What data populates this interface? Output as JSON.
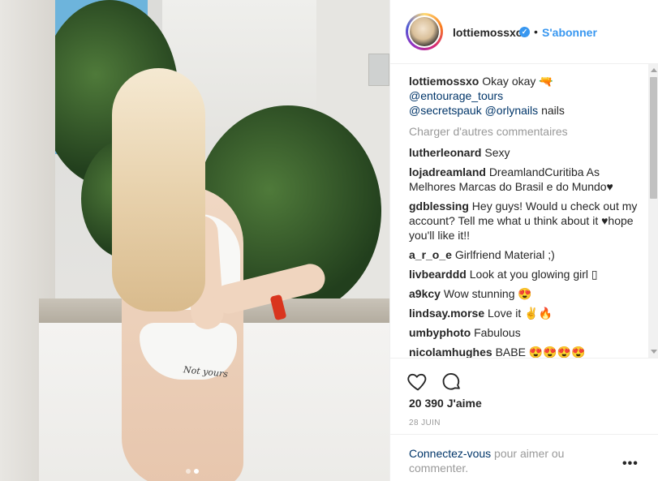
{
  "post": {
    "username": "lottiemossxo",
    "separator": "•",
    "follow_label": "S'abonner",
    "caption": {
      "user": "lottiemossxo",
      "text": "Okay okay 🔫",
      "mention_1": "@entourage_tours",
      "mention_2": "@secretspauk",
      "mention_3": "@orlynails",
      "text_end": "nails"
    },
    "load_more": "Charger d'autres commentaires",
    "comments": [
      {
        "user": "lutherleonard",
        "text": "Sexy"
      },
      {
        "user": "lojadreamland",
        "text": "DreamlandCuritiba As Melhores Marcas do Brasil e do Mundo♥"
      },
      {
        "user": "gdblessing",
        "text": "Hey guys! Would u check out my account? Tell me what u think about it ♥hope you'll like it!!"
      },
      {
        "user": "a_r_o_e",
        "text": "Girlfriend Material ;)"
      },
      {
        "user": "livbearddd",
        "text": "Look at you glowing girl ▯"
      },
      {
        "user": "a9kcy",
        "text": "Wow stunning 😍"
      },
      {
        "user": "lindsay.morse",
        "text": "Love it ✌🔥"
      },
      {
        "user": "umbyphoto",
        "text": "Fabulous"
      },
      {
        "user": "nicolamhughes",
        "text": "BABE 😍😍😍😍"
      }
    ],
    "likes": "20 390 J'aime",
    "date": "28 JUIN",
    "login_link": "Connectez-vous",
    "login_rest": " pour aimer ou commenter.",
    "more_label": "•••",
    "photo_tattoo": "Not yours",
    "carousel_count": 2,
    "carousel_active": 2
  },
  "icons": {
    "heart": "heart-icon",
    "comment": "comment-icon",
    "verified": "verified-badge-icon",
    "more": "more-options-icon"
  },
  "colors": {
    "link": "#3897f0",
    "mention": "#003569",
    "muted": "#999999",
    "text": "#262626"
  }
}
